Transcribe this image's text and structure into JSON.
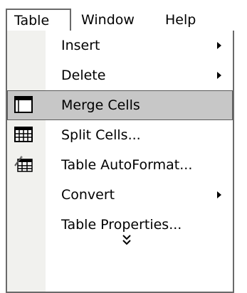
{
  "menubar": {
    "items": [
      {
        "label": "Table"
      },
      {
        "label": "Window"
      },
      {
        "label": "Help"
      }
    ]
  },
  "dropdown": {
    "items": [
      {
        "label": "Insert",
        "submenu": true
      },
      {
        "label": "Delete",
        "submenu": true
      },
      {
        "label": "Merge Cells",
        "icon": "merge-cells-icon",
        "highlighted": true
      },
      {
        "label": "Split Cells...",
        "icon": "split-cells-icon"
      },
      {
        "label": "Table AutoFormat...",
        "icon": "table-autoformat-icon"
      },
      {
        "label": "Convert",
        "submenu": true
      },
      {
        "label": "Table Properties..."
      }
    ],
    "expand_icon": "double-chevron-down-icon"
  }
}
